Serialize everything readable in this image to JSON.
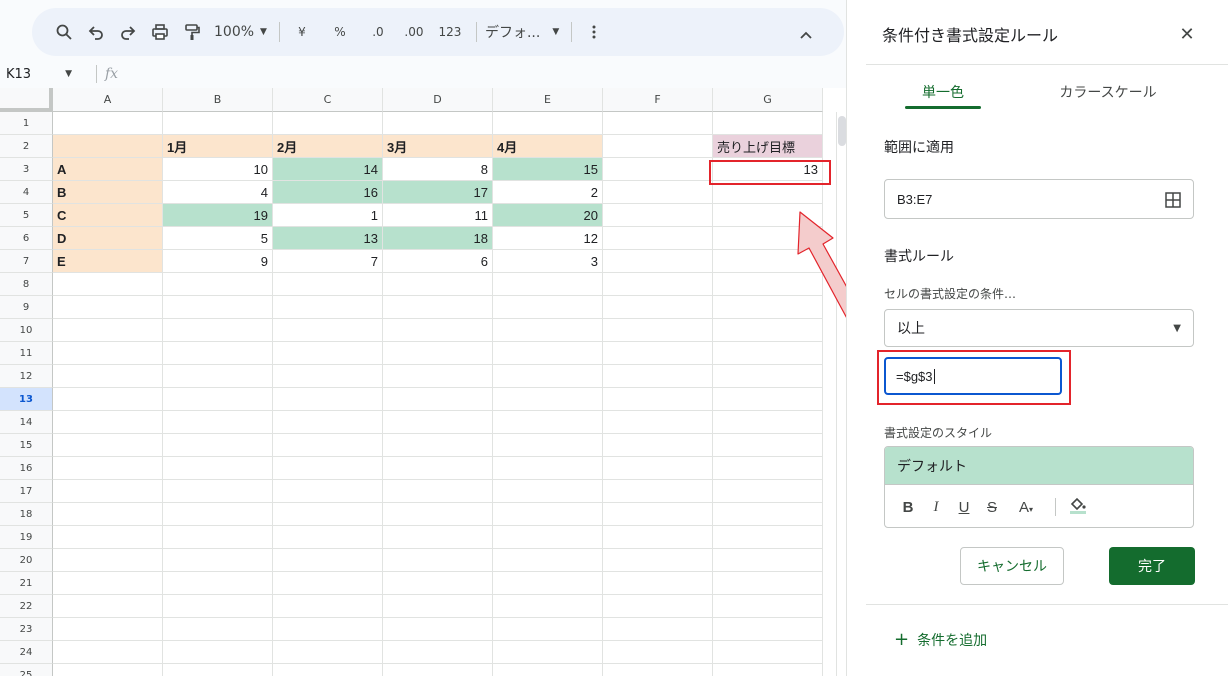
{
  "toolbar": {
    "zoom": "100%",
    "currency": "¥",
    "percent": "%",
    "dec_decrease": ".0",
    "dec_increase": ".00",
    "number_format": "123",
    "font": "デフォ..."
  },
  "formula_bar": {
    "name_box": "K13",
    "fx": "fx"
  },
  "columns": [
    "A",
    "B",
    "C",
    "D",
    "E",
    "F",
    "G"
  ],
  "rows": [
    "1",
    "2",
    "3",
    "4",
    "5",
    "6",
    "7",
    "8",
    "9",
    "10",
    "11",
    "12",
    "13",
    "14",
    "15",
    "16",
    "17",
    "18",
    "19",
    "20",
    "21",
    "22",
    "23",
    "24",
    "25"
  ],
  "active_row": "13",
  "sheet": {
    "month_headers": [
      "1月",
      "2月",
      "3月",
      "4月"
    ],
    "target_label": "売り上げ目標",
    "target_value": "13",
    "data_rows": [
      {
        "label": "A",
        "values": [
          "10",
          "14",
          "8",
          "15"
        ]
      },
      {
        "label": "B",
        "values": [
          "4",
          "16",
          "17",
          "2"
        ]
      },
      {
        "label": "C",
        "values": [
          "19",
          "1",
          "11",
          "20"
        ]
      },
      {
        "label": "D",
        "values": [
          "5",
          "13",
          "18",
          "12"
        ]
      },
      {
        "label": "E",
        "values": [
          "9",
          "7",
          "6",
          "3"
        ]
      }
    ]
  },
  "colors": {
    "peach": "#fce5cd",
    "highlight_green": "#b7e1cd",
    "target_pink": "#ead1dc",
    "accent_green": "#146c2e",
    "annotation_red": "#e3242b"
  },
  "panel": {
    "title": "条件付き書式設定ルール",
    "tabs": [
      "単一色",
      "カラースケール"
    ],
    "apply_range_label": "範囲に適用",
    "range_value": "B3:E7",
    "format_rules_label": "書式ルール",
    "condition_label": "セルの書式設定の条件…",
    "condition_value": "以上",
    "value_input": "=$g$3",
    "style_label": "書式設定のスタイル",
    "style_preview": "デフォルト",
    "cancel_label": "キャンセル",
    "done_label": "完了",
    "add_condition_label": "条件を追加"
  }
}
